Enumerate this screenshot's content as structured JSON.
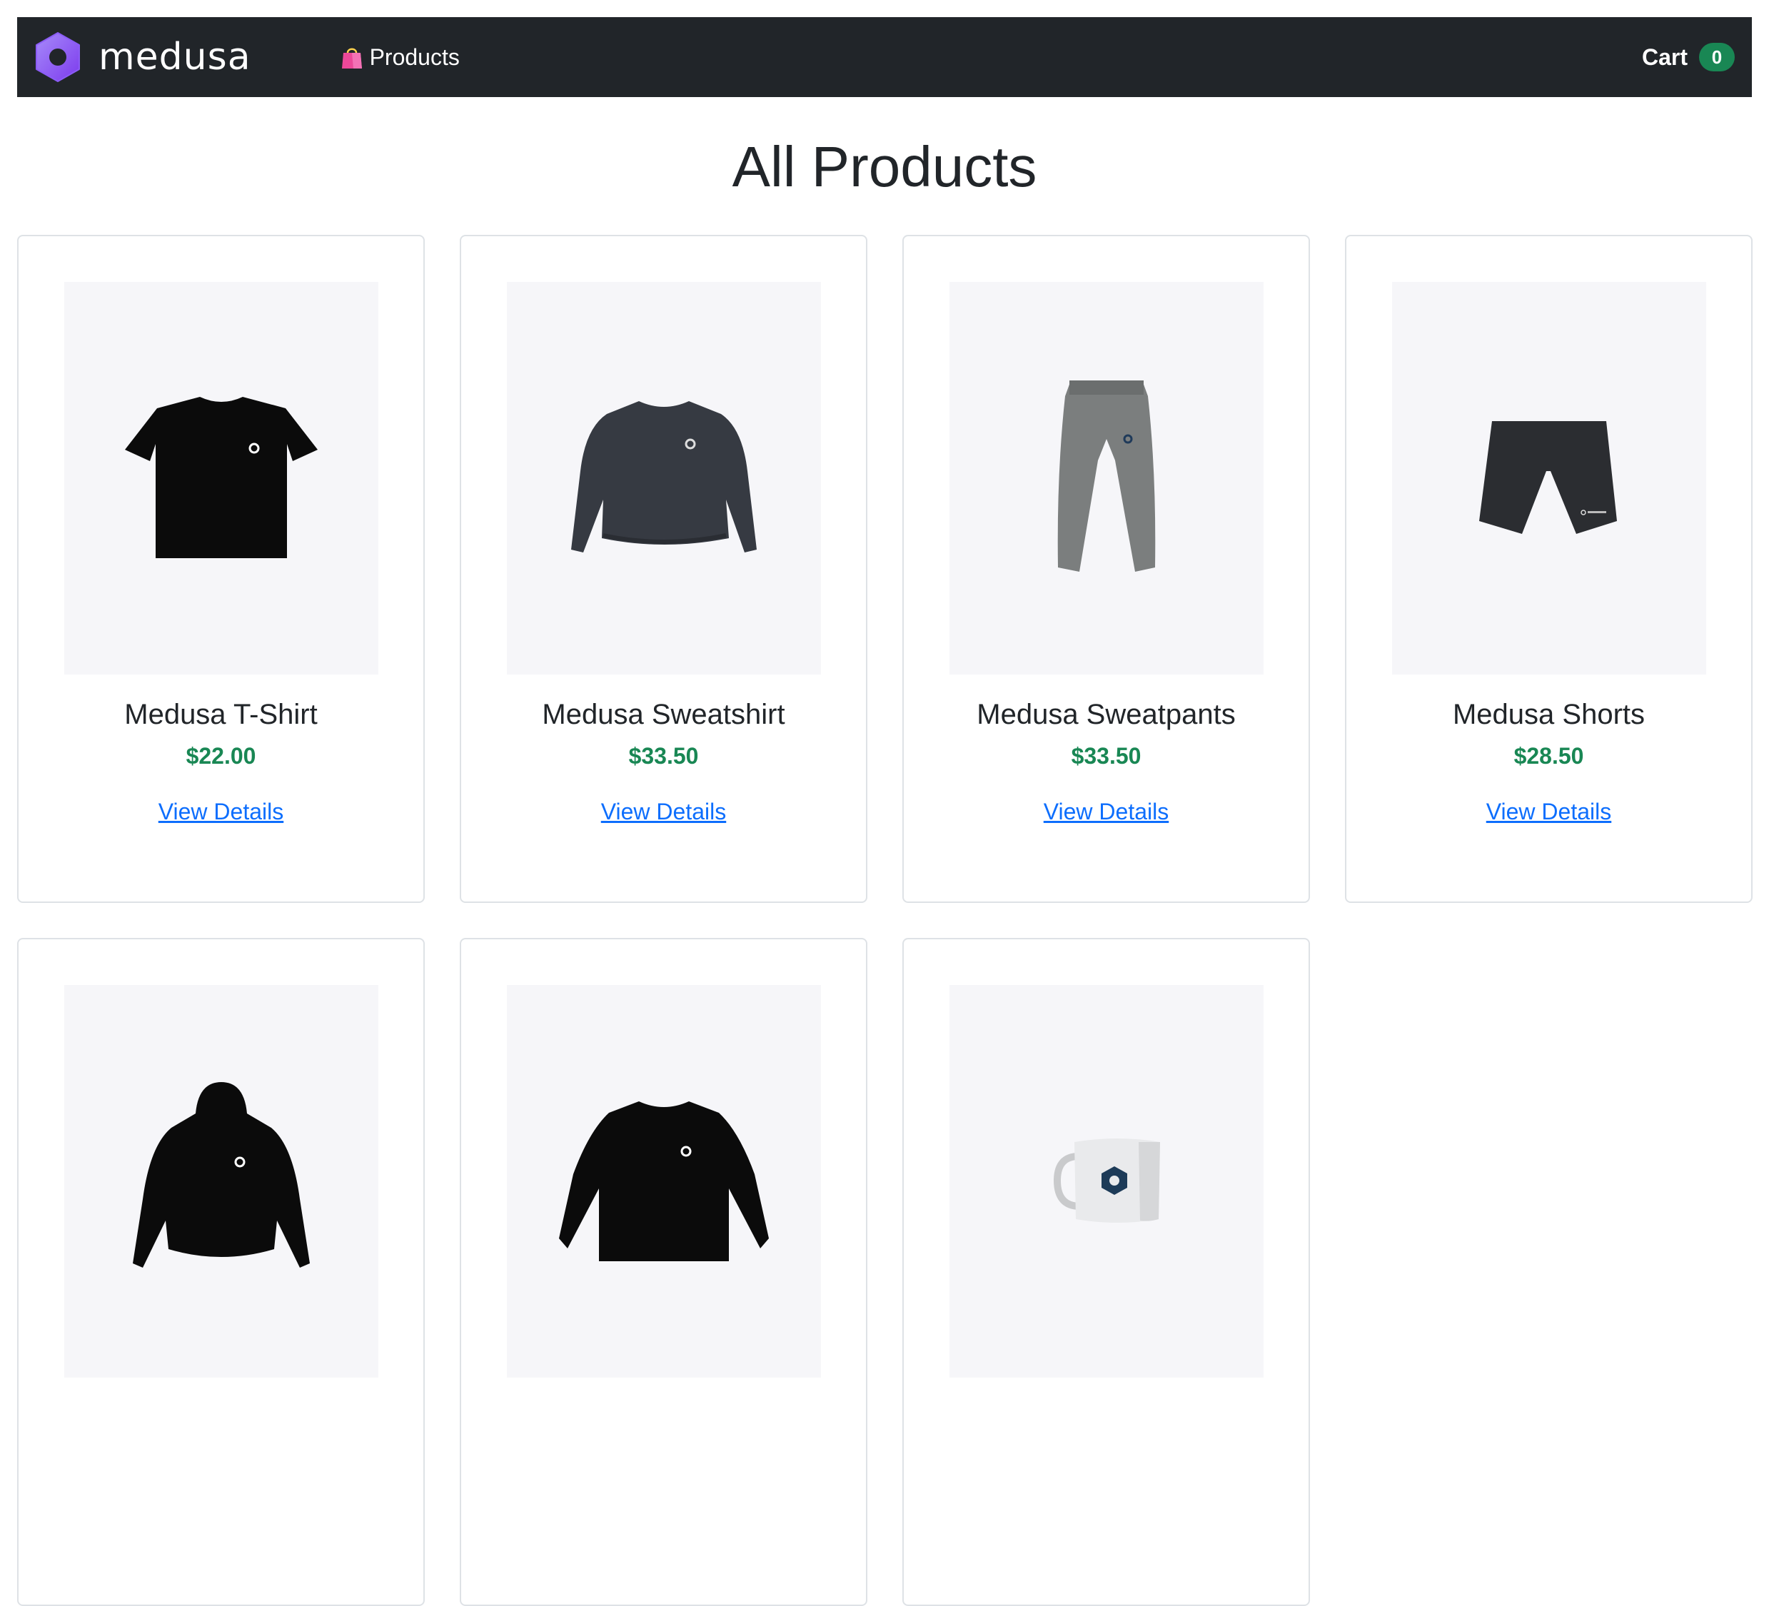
{
  "navbar": {
    "brand_name": "medusa",
    "brand_logo_icon": "medusa-logo-icon",
    "products_icon": "shopping-bag-icon",
    "products_label": "Products",
    "cart_label": "Cart",
    "cart_count": "0",
    "background_color": "#212529",
    "badge_color": "#198754"
  },
  "page": {
    "title": "All Products"
  },
  "products": [
    {
      "title": "Medusa T-Shirt",
      "price": "$22.00",
      "link_label": "View Details",
      "image_icon": "t-shirt-image"
    },
    {
      "title": "Medusa Sweatshirt",
      "price": "$33.50",
      "link_label": "View Details",
      "image_icon": "sweatshirt-image"
    },
    {
      "title": "Medusa Sweatpants",
      "price": "$33.50",
      "link_label": "View Details",
      "image_icon": "sweatpants-image"
    },
    {
      "title": "Medusa Shorts",
      "price": "$28.50",
      "link_label": "View Details",
      "image_icon": "shorts-image"
    },
    {
      "title": "",
      "price": "",
      "link_label": "",
      "image_icon": "hoodie-image"
    },
    {
      "title": "",
      "price": "",
      "link_label": "",
      "image_icon": "longsleeve-image"
    },
    {
      "title": "",
      "price": "",
      "link_label": "",
      "image_icon": "mug-image"
    }
  ],
  "colors": {
    "price": "#198754",
    "link": "#0d6efd",
    "image_background": "#f6f6f9"
  }
}
